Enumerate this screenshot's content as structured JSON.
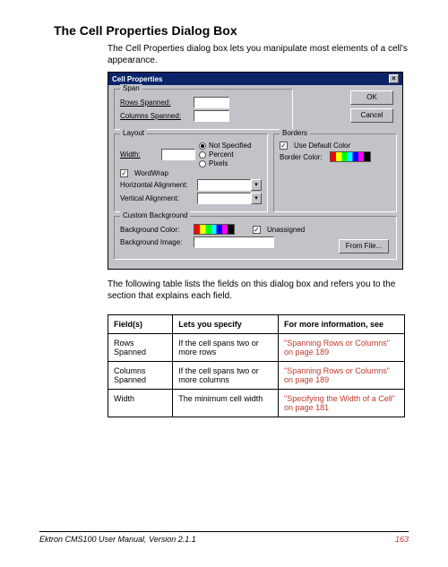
{
  "heading": "The Cell Properties Dialog Box",
  "intro": "The Cell Properties dialog box lets you manipulate most elements of a cell's appearance.",
  "dialog": {
    "title": "Cell Properties",
    "ok": "OK",
    "cancel": "Cancel",
    "span_group": "Span",
    "rows_spanned": "Rows Spanned:",
    "columns_spanned": "Columns Spanned:",
    "layout_group": "Layout",
    "width": "Width:",
    "not_specified": "Not Specified",
    "percent": "Percent",
    "pixels": "Pixels",
    "word_wrap": "WordWrap",
    "h_align": "Horizontal Alignment:",
    "v_align": "Vertical Alignment:",
    "borders_group": "Borders",
    "use_default_color": "Use Default Color",
    "border_color": "Border Color:",
    "custom_bg_group": "Custom Background",
    "background_color": "Background Color:",
    "unassigned": "Unassigned",
    "background_image": "Background Image:",
    "from_file": "From File..."
  },
  "following_text": "The following table lists the fields on this dialog box and refers you to the section that explains each field.",
  "table": {
    "headers": [
      "Field(s)",
      "Lets you specify",
      "For more information, see"
    ],
    "rows": [
      {
        "field": "Rows Spanned",
        "spec": "If the cell spans two or more rows",
        "ref": "\"Spanning Rows or Columns\" on page 189"
      },
      {
        "field": "Columns Spanned",
        "spec": "If the cell spans two or more columns",
        "ref": "\"Spanning Rows or Columns\" on page 189"
      },
      {
        "field": "Width",
        "spec": "The minimum cell width",
        "ref": "\"Specifying the Width of a Cell\" on page 181"
      }
    ]
  },
  "footer": {
    "text": "Ektron CMS100 User Manual, Version 2.1.1",
    "page": "163"
  }
}
